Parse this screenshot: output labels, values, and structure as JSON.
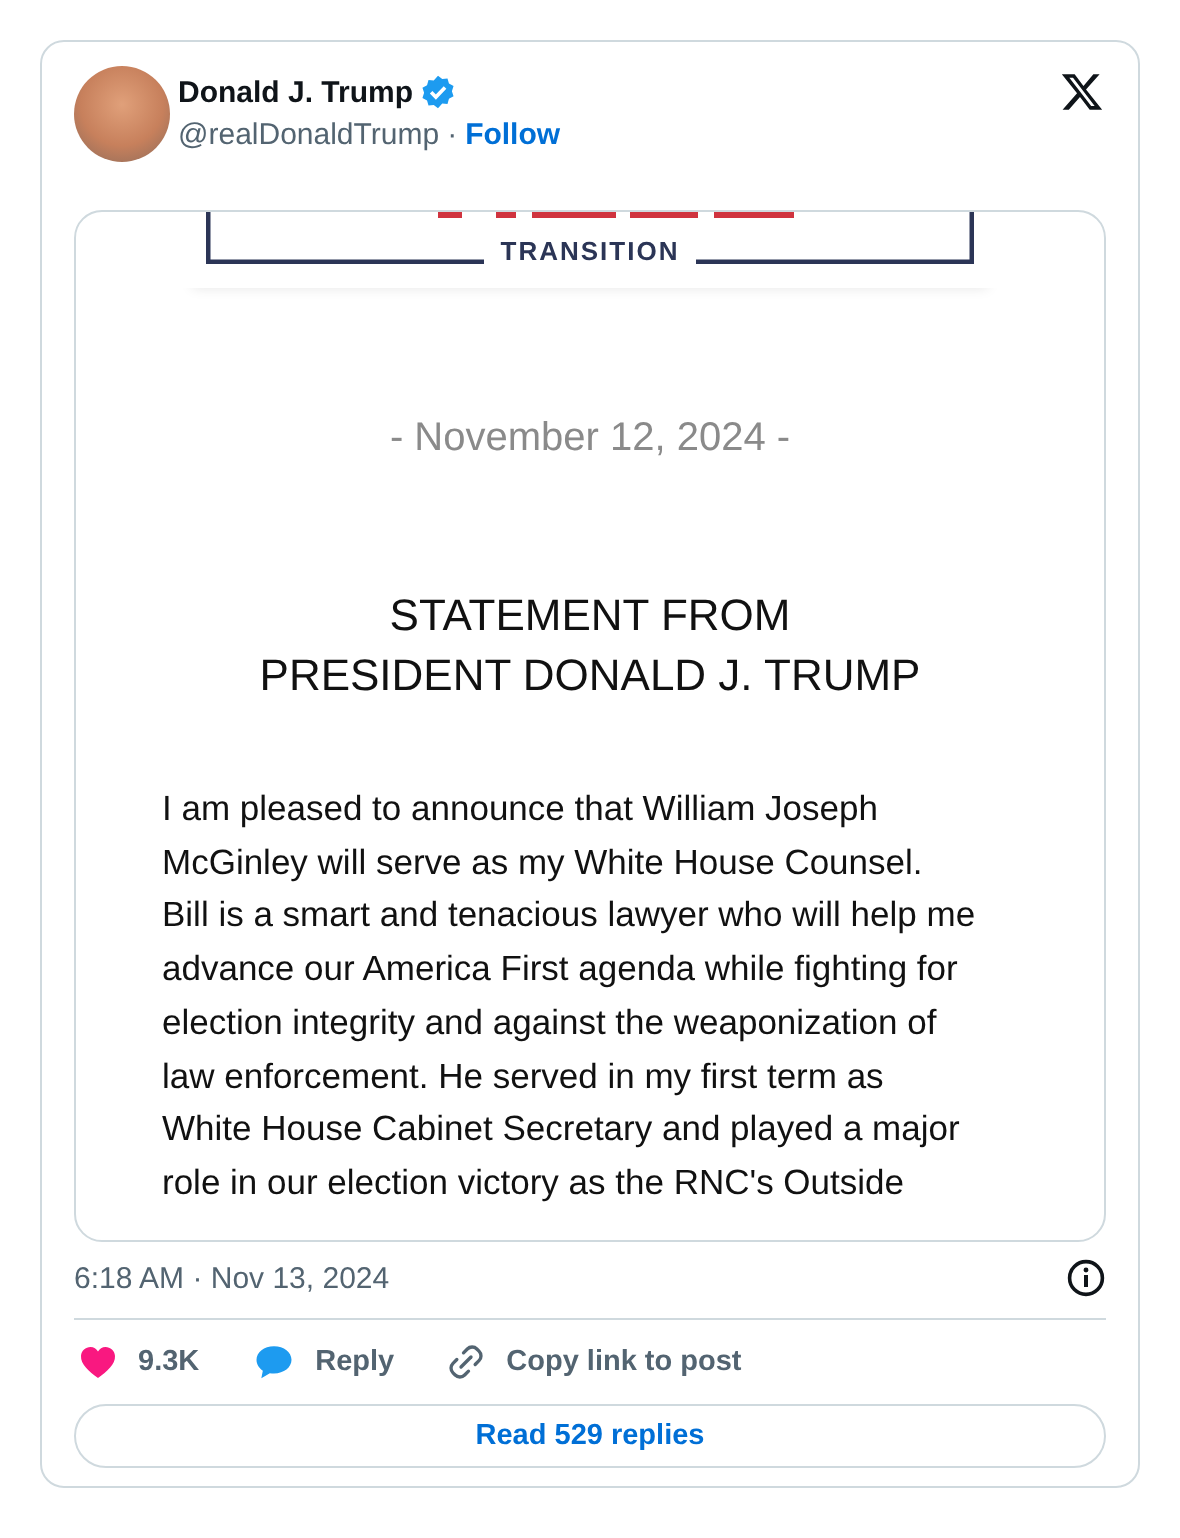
{
  "author": {
    "name": "Donald J. Trump",
    "verified": true,
    "handle": "@realDonaldTrump",
    "separator": "·",
    "follow": "Follow"
  },
  "document": {
    "logo_caption": "TRANSITION",
    "date": "- November 12, 2024 -",
    "heading_lines": [
      "STATEMENT FROM",
      "PRESIDENT DONALD J. TRUMP"
    ],
    "body_lines": [
      "I am pleased to announce that William Joseph",
      "McGinley will serve as my White House Counsel.",
      "Bill is a smart and tenacious lawyer who will help me",
      "advance our America First agenda while fighting for",
      "election integrity and against the weaponization of",
      "law enforcement. He served in my first term as",
      "White House Cabinet Secretary and played a major",
      "role in our election victory as the RNC's Outside"
    ]
  },
  "timestamp": "6:18 AM · Nov 13, 2024",
  "actions": [
    {
      "kind": "like",
      "label": "9.3K",
      "color": "#f91880"
    },
    {
      "kind": "reply",
      "label": "Reply",
      "color": "#1d9bf0"
    },
    {
      "kind": "copy",
      "label": "Copy link to post",
      "color": "#536471"
    }
  ],
  "read_replies": "Read 529 replies"
}
